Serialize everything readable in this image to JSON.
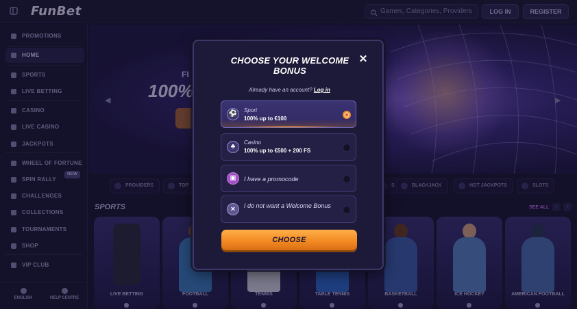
{
  "header": {
    "logo": "FunBet",
    "search_placeholder": "Games, Categories, Providers",
    "login": "LOG IN",
    "register": "REGISTER"
  },
  "sidebar": {
    "items": [
      {
        "label": "PROMOTIONS"
      },
      {
        "label": "HOME"
      },
      {
        "label": "SPORTS"
      },
      {
        "label": "LIVE BETTING"
      },
      {
        "label": "CASINO"
      },
      {
        "label": "LIVE CASINO"
      },
      {
        "label": "JACKPOTS"
      },
      {
        "label": "WHEEL OF FORTUNE"
      },
      {
        "label": "SPIN RALLY"
      },
      {
        "label": "CHALLENGES"
      },
      {
        "label": "COLLECTIONS"
      },
      {
        "label": "TOURNAMENTS"
      },
      {
        "label": "SHOP"
      },
      {
        "label": "VIP CLUB"
      }
    ],
    "new_badge": "NEW",
    "footer": {
      "language": "ENGLISH",
      "help": "HELP CENTRE"
    }
  },
  "hero": {
    "line1": "FI",
    "line2": "100%"
  },
  "categories": [
    "PROVIDERS",
    "TOP",
    "S",
    "BLACKJACK",
    "HOT JACKPOTS",
    "SLOTS"
  ],
  "sports": {
    "title": "SPORTS",
    "see_all": "SEE ALL",
    "cards": [
      "LIVE BETTING",
      "FOOTBALL",
      "TENNIS",
      "TABLE TENNIS",
      "BASKETBALL",
      "ICE HOCKEY",
      "AMERICAN FOOTBALL"
    ]
  },
  "modal": {
    "title_line1": "CHOOSE YOUR WELCOME",
    "title_line2": "BONUS",
    "close": "✕",
    "account_text": "Already have an account?",
    "login_link": "Log in",
    "options": [
      {
        "label": "Sport",
        "value": "100% up to €100",
        "selected": true
      },
      {
        "label": "Casino",
        "value": "100% up to €500 + 200 FS",
        "selected": false
      },
      {
        "text": "I have a promocode",
        "selected": false
      },
      {
        "text": "I do not want a Welcome Bonus",
        "selected": false
      }
    ],
    "choose_button": "CHOOSE"
  },
  "colors": {
    "accent_orange": "#f38a22",
    "modal_bg": "#1d1938",
    "page_bg": "#1a1634"
  }
}
